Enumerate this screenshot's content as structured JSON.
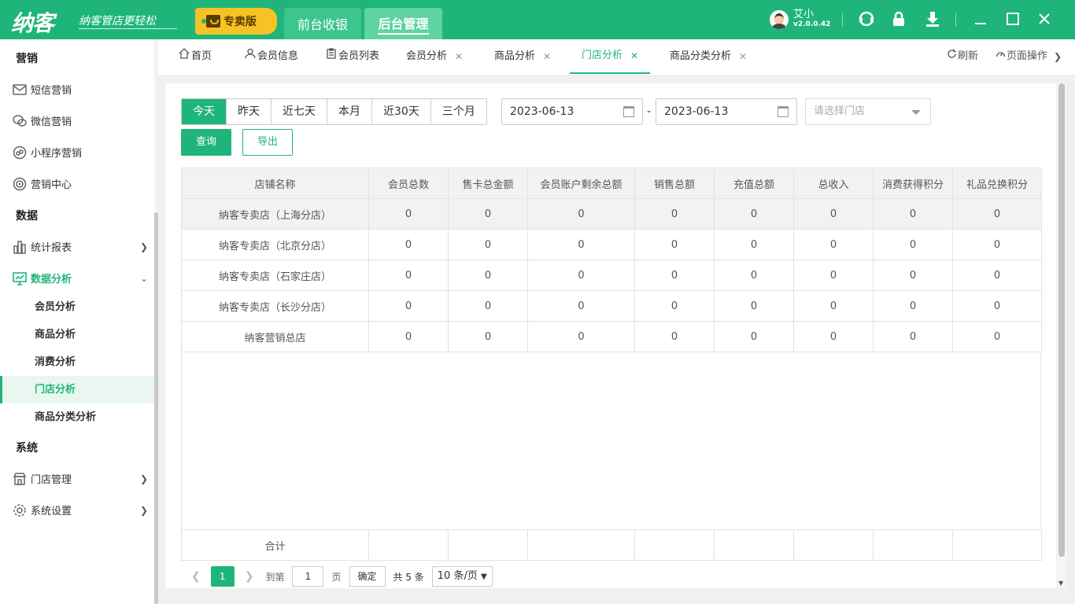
{
  "brand": {
    "logo": "纳客",
    "slogan": "纳客管店更轻松",
    "edition": "专卖版"
  },
  "top_tabs": [
    {
      "label": "前台收银"
    },
    {
      "label": "后台管理"
    }
  ],
  "user": {
    "name": "艾小",
    "version": "v2.0.0.42"
  },
  "sidebar": {
    "sections": [
      "营销",
      "数据",
      "系统"
    ],
    "items": [
      {
        "label": "短信营销",
        "icon": "mail-icon"
      },
      {
        "label": "微信营销",
        "icon": "wechat-icon"
      },
      {
        "label": "小程序营销",
        "icon": "miniprogram-icon"
      },
      {
        "label": "营销中心",
        "icon": "target-icon"
      },
      {
        "label": "统计报表",
        "icon": "bar-chart-icon"
      },
      {
        "label": "数据分析",
        "icon": "monitor-chart-icon"
      },
      {
        "label": "门店管理",
        "icon": "store-icon"
      },
      {
        "label": "系统设置",
        "icon": "gear-icon"
      }
    ],
    "sub_items": [
      "会员分析",
      "商品分析",
      "消费分析",
      "门店分析",
      "商品分类分析"
    ]
  },
  "page_tabs": [
    {
      "label": "首页"
    },
    {
      "label": "会员信息"
    },
    {
      "label": "会员列表"
    },
    {
      "label": "会员分析"
    },
    {
      "label": "商品分析"
    },
    {
      "label": "门店分析"
    },
    {
      "label": "商品分类分析"
    }
  ],
  "tab_actions": {
    "refresh": "刷新",
    "page_ops": "页面操作"
  },
  "filters": {
    "ranges": [
      "今天",
      "昨天",
      "近七天",
      "本月",
      "近30天",
      "三个月"
    ],
    "active_range": "今天",
    "start_date": "2023-06-13",
    "end_date": "2023-06-13",
    "store_placeholder": "请选择门店",
    "query": "查询",
    "export": "导出"
  },
  "table": {
    "headers": [
      "店铺名称",
      "会员总数",
      "售卡总金额",
      "会员账户剩余总额",
      "销售总额",
      "充值总额",
      "总收入",
      "消费获得积分",
      "礼品兑换积分"
    ],
    "rows": [
      [
        "纳客专卖店（上海分店）",
        "0",
        "0",
        "0",
        "0",
        "0",
        "0",
        "0",
        "0"
      ],
      [
        "纳客专卖店（北京分店）",
        "0",
        "0",
        "0",
        "0",
        "0",
        "0",
        "0",
        "0"
      ],
      [
        "纳客专卖店（石家庄店）",
        "0",
        "0",
        "0",
        "0",
        "0",
        "0",
        "0",
        "0"
      ],
      [
        "纳客专卖店（长沙分店）",
        "0",
        "0",
        "0",
        "0",
        "0",
        "0",
        "0",
        "0"
      ],
      [
        "纳客营销总店",
        "0",
        "0",
        "0",
        "0",
        "0",
        "0",
        "0",
        "0"
      ]
    ],
    "total_label": "合计"
  },
  "pager": {
    "current": "1",
    "goto_label": "到第",
    "page_input": "1",
    "page_unit": "页",
    "confirm": "确定",
    "total": "共 5 条",
    "size": "10 条/页"
  }
}
